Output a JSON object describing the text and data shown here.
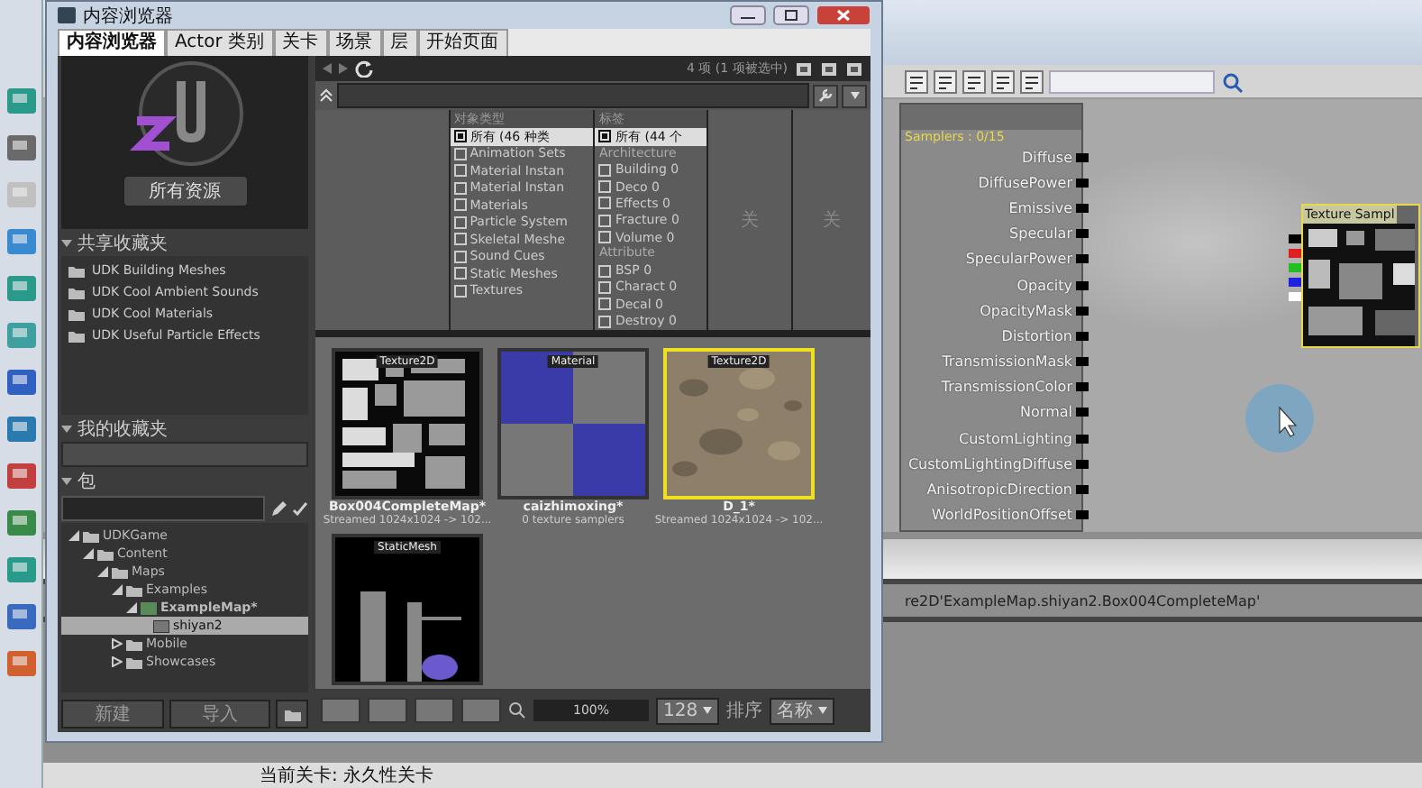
{
  "browser": {
    "title": "内容浏览器",
    "tabs": [
      {
        "label": "内容浏览器",
        "selected": true
      },
      {
        "label": "Actor 类别",
        "selected": false
      },
      {
        "label": "关卡",
        "selected": false
      },
      {
        "label": "场景",
        "selected": false
      },
      {
        "label": "层",
        "selected": false
      },
      {
        "label": "开始页面",
        "selected": false
      }
    ],
    "all_assets_button": "所有资源",
    "shared_favorites": {
      "title": "共享收藏夹",
      "items": [
        "UDK Building Meshes",
        "UDK Cool Ambient Sounds",
        "UDK Cool Materials",
        "UDK Useful Particle Effects"
      ]
    },
    "my_favorites": {
      "title": "我的收藏夹"
    },
    "packages": {
      "title": "包",
      "tree": [
        {
          "label": "UDKGame",
          "expanded": true,
          "selected": false,
          "children": [
            {
              "label": "Content",
              "expanded": true,
              "selected": false,
              "children": [
                {
                  "label": "Maps",
                  "expanded": true,
                  "selected": false,
                  "children": [
                    {
                      "label": "Examples",
                      "expanded": true,
                      "selected": false,
                      "children": [
                        {
                          "label": "ExampleMap*",
                          "kind": "map",
                          "expanded": true,
                          "selected": false,
                          "children": [
                            {
                              "label": "shiyan2",
                              "kind": "group",
                              "selected": true
                            }
                          ]
                        }
                      ]
                    },
                    {
                      "label": "Mobile",
                      "expanded": false,
                      "selected": false
                    },
                    {
                      "label": "Showcases",
                      "expanded": false,
                      "selected": false
                    }
                  ]
                }
              ]
            }
          ]
        }
      ]
    },
    "buttons": [
      "新建",
      "导入"
    ],
    "item_count": "4 项 (1 项被选中)",
    "filters": {
      "type_column": {
        "title": "对象类型",
        "all": {
          "label": "所有 (46 种类",
          "checked": true
        },
        "items": [
          {
            "label": "Animation Sets",
            "checked": false
          },
          {
            "label": "Material Instan",
            "checked": false
          },
          {
            "label": "Material Instan",
            "checked": false
          },
          {
            "label": "Materials",
            "checked": false
          },
          {
            "label": "Particle System",
            "checked": false
          },
          {
            "label": "Skeletal Meshe",
            "checked": false
          },
          {
            "label": "Sound Cues",
            "checked": false
          },
          {
            "label": "Static Meshes",
            "checked": false
          },
          {
            "label": "Textures",
            "checked": false
          }
        ]
      },
      "tag_column": {
        "title": "标签",
        "all": {
          "label": "所有 (44 个",
          "checked": true
        },
        "groups": [
          {
            "title": "Architecture",
            "items": [
              {
                "label": "Building",
                "count": "0",
                "checked": false
              },
              {
                "label": "Deco",
                "count": "0",
                "checked": false
              },
              {
                "label": "Effects",
                "count": "0",
                "checked": false
              },
              {
                "label": "Fracture",
                "count": "0",
                "checked": false
              },
              {
                "label": "Volume",
                "count": "0",
                "checked": false
              }
            ]
          },
          {
            "title": "Attribute",
            "items": [
              {
                "label": "BSP",
                "count": "0",
                "checked": false
              },
              {
                "label": "Charact",
                "count": "0",
                "checked": false
              },
              {
                "label": "Decal",
                "count": "0",
                "checked": false
              },
              {
                "label": "Destroy",
                "count": "0",
                "checked": false
              }
            ]
          }
        ]
      },
      "extra_columns": [
        "关",
        "关"
      ]
    },
    "assets": [
      {
        "name": "Box004CompleteMap*",
        "type": "Texture2D",
        "info": "Streamed 1024x1024 -> 102...",
        "kind": "texture-atlas",
        "selected": false
      },
      {
        "name": "caizhimoxing*",
        "type": "Material",
        "info": "0 texture samplers",
        "kind": "material",
        "selected": false
      },
      {
        "name": "D_1*",
        "type": "Texture2D",
        "info": "Streamed 1024x1024 -> 102...",
        "kind": "texture-ground",
        "selected": true
      },
      {
        "type": "StaticMesh",
        "kind": "mesh",
        "selected": false
      }
    ],
    "zoom": "100%",
    "thumb_size": "128",
    "sort_label": "排序",
    "sort_value": "名称"
  },
  "material": {
    "samplers": "Samplers : 0/15",
    "inputs": [
      "Diffuse",
      "DiffusePower",
      "Emissive",
      "Specular",
      "SpecularPower",
      "Opacity",
      "OpacityMask",
      "Distortion",
      "TransmissionMask",
      "TransmissionColor",
      "Normal",
      "CustomLighting",
      "CustomLightingDiffuse",
      "AnisotropicDirection",
      "WorldPositionOffset"
    ],
    "texture_node": {
      "title": "Texture Sampl",
      "pins": [
        {
          "color": "#000000"
        },
        {
          "color": "#e02020"
        },
        {
          "color": "#20c020"
        },
        {
          "color": "#2020e0"
        },
        {
          "color": "#ffffff"
        }
      ]
    }
  },
  "path": "re2D'ExampleMap.shiyan2.Box004CompleteMap'",
  "status": "当前关卡: 永久性关卡"
}
